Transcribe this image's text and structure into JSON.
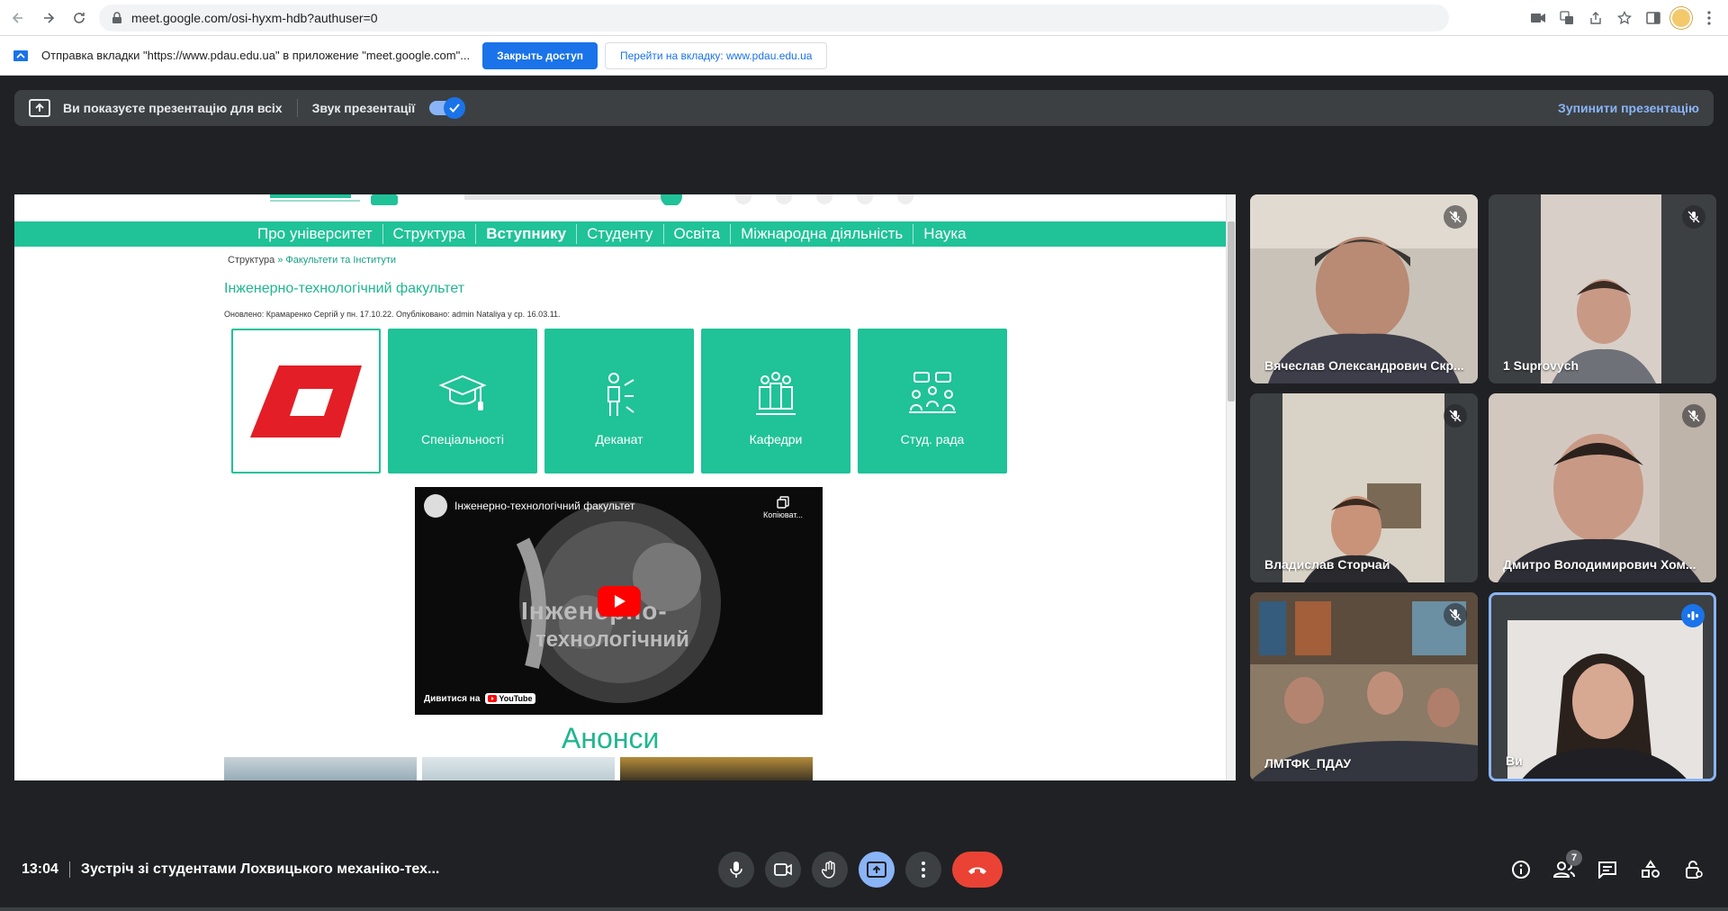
{
  "browser": {
    "url": "meet.google.com/osi-hyxm-hdb?authuser=0"
  },
  "infobar": {
    "message": "Отправка вкладки \"https://www.pdau.edu.ua\" в приложение \"meet.google.com\"...",
    "stop_sharing_label": "Закрыть доступ",
    "switch_tab_label": "Перейти на вкладку: www.pdau.edu.ua"
  },
  "presentation_bar": {
    "status": "Ви показуєте презентацію для всіх",
    "audio_label": "Звук презентації",
    "audio_enabled": true,
    "stop_label": "Зупинити презентацію"
  },
  "shared_page": {
    "nav": [
      "Про університет",
      "Структура",
      "Вступнику",
      "Студенту",
      "Освіта",
      "Міжнародна діяльність",
      "Наука"
    ],
    "active_nav": "Вступнику",
    "breadcrumb_root": "Структура",
    "breadcrumb_sep": " » ",
    "breadcrumb_link": "Факультети та Інститути",
    "heading": "Інженерно-технологічний факультет",
    "meta": "Оновлено: Крамаренко Сергій у пн. 17.10.22. Опубліковано: admin Nataliya у ср. 16.03.11.",
    "tiles": [
      {
        "label": "Спеціальності",
        "icon": "graduation-cap-icon"
      },
      {
        "label": "Деканат",
        "icon": "presenter-icon"
      },
      {
        "label": "Кафедри",
        "icon": "group-icon"
      },
      {
        "label": "Студ. рада",
        "icon": "discussion-icon"
      }
    ],
    "video": {
      "title": "Інженерно-технологічний факультет",
      "copy_label": "Копіюват...",
      "watch_label": "Дивитися на",
      "youtube_label": "YouTube",
      "overlay_line1": "Інженерно-",
      "overlay_line2": "технологічний"
    },
    "announcements": "Анонси"
  },
  "participants": [
    {
      "name": "Вячеслав Олександрович Скр...",
      "muted": true
    },
    {
      "name": "1 Suprovych",
      "muted": true
    },
    {
      "name": "Владислав Сторчай",
      "muted": true
    },
    {
      "name": "Дмитро Володимирович Хом...",
      "muted": true
    },
    {
      "name": "ЛМТФК_ПДАУ",
      "muted": true
    },
    {
      "name": "Ви",
      "muted": false
    }
  ],
  "meeting": {
    "time": "13:04",
    "title": "Зустріч зі студентами Лохвицького механіко-тех...",
    "participant_count": "7"
  },
  "colors": {
    "accent": "#8ab4f8",
    "brand_green": "#20c298",
    "end_call": "#ea4335"
  }
}
